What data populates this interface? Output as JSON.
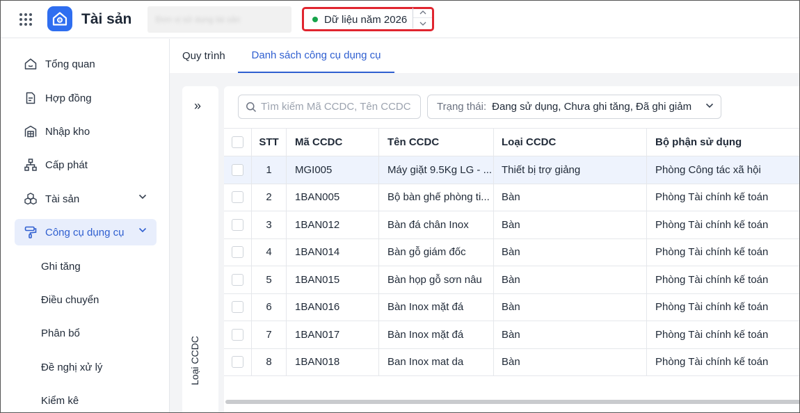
{
  "header": {
    "app_title": "Tài sản",
    "org_name_blurred": "Đơn vị sử dụng tài sản",
    "year_label": "Dữ liệu năm 2026",
    "year_status_color": "#16a34a",
    "highlight_color": "#e0252f"
  },
  "sidebar": {
    "items": [
      {
        "label": "Tổng quan",
        "icon": "home-icon"
      },
      {
        "label": "Hợp đồng",
        "icon": "document-icon"
      },
      {
        "label": "Nhập kho",
        "icon": "warehouse-icon"
      },
      {
        "label": "Cấp phát",
        "icon": "hierarchy-icon"
      },
      {
        "label": "Tài sản",
        "icon": "cubes-icon"
      },
      {
        "label": "Công cụ dụng cụ",
        "icon": "paint-roller-icon"
      }
    ],
    "subitems": [
      "Ghi tăng",
      "Điều chuyển",
      "Phân bổ",
      "Đề nghị xử lý",
      "Kiểm kê"
    ],
    "active_color": "#2f5fd0"
  },
  "tabs": [
    "Quy trình",
    "Danh sách công cụ dụng cụ"
  ],
  "side_panel": {
    "label": "Loại CCDC",
    "expand_glyph": "»"
  },
  "search": {
    "placeholder": "Tìm kiếm Mã CCDC, Tên CCDC"
  },
  "filter": {
    "label": "Trạng thái:",
    "value": "Đang sử dụng, Chưa ghi tăng, Đã ghi giảm"
  },
  "table": {
    "columns": [
      "STT",
      "Mã CCDC",
      "Tên CCDC",
      "Loại CCDC",
      "Bộ phận sử dụng"
    ],
    "rows": [
      {
        "stt": "1",
        "ma": "MGI005",
        "ten": "Máy giặt 9.5Kg LG - ...",
        "loai": "Thiết bị trợ giảng",
        "bophan": "Phòng Công tác xã hội"
      },
      {
        "stt": "2",
        "ma": "1BAN005",
        "ten": "Bộ bàn ghế phòng ti...",
        "loai": "Bàn",
        "bophan": "Phòng Tài chính kế toán"
      },
      {
        "stt": "3",
        "ma": "1BAN012",
        "ten": "Bàn đá chân Inox",
        "loai": "Bàn",
        "bophan": "Phòng Tài chính kế toán"
      },
      {
        "stt": "4",
        "ma": "1BAN014",
        "ten": "Bàn gỗ giám đốc",
        "loai": "Bàn",
        "bophan": "Phòng Tài chính kế toán"
      },
      {
        "stt": "5",
        "ma": "1BAN015",
        "ten": "Bàn họp gỗ sơn nâu",
        "loai": "Bàn",
        "bophan": "Phòng Tài chính kế toán"
      },
      {
        "stt": "6",
        "ma": "1BAN016",
        "ten": "Bàn Inox mặt đá",
        "loai": "Bàn",
        "bophan": "Phòng Tài chính kế toán"
      },
      {
        "stt": "7",
        "ma": "1BAN017",
        "ten": "Bàn Inox mặt đá",
        "loai": "Bàn",
        "bophan": "Phòng Tài chính kế toán"
      },
      {
        "stt": "8",
        "ma": "1BAN018",
        "ten": "Ban Inox mat da",
        "loai": "Bàn",
        "bophan": "Phòng Tài chính kế toán"
      }
    ]
  }
}
